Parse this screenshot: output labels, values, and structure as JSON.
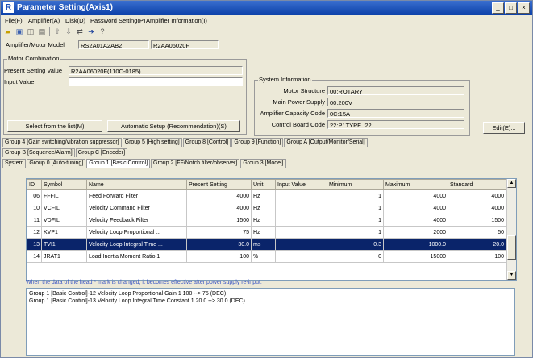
{
  "window": {
    "title": "Parameter Setting(Axis1)",
    "icon_letter": "R",
    "min_glyph": "_",
    "max_glyph": "□",
    "close_glyph": "×"
  },
  "menu": [
    "File(F)",
    "Amplifier(A)",
    "Disk(D)",
    "Password Setting(P)",
    "Amplifier Information(I)"
  ],
  "amp_motor": {
    "label": "Amplifier/Motor Model",
    "amp_value": "RS2A01A2AB2",
    "motor_value": "R2AA06020F"
  },
  "motor_combination": {
    "title": "Motor Combination",
    "present_label": "Present Setting Value",
    "present_value": "R2AA06020F(110C-0185)",
    "input_label": "Input Value",
    "input_value": "",
    "select_button": "Select from the list(M)",
    "auto_button": "Automatic Setup (Recommendation)(S)"
  },
  "system_info": {
    "title": "System Information",
    "rows": [
      {
        "label": "Motor Structure",
        "value": "00:ROTARY"
      },
      {
        "label": "Main Power Supply",
        "value": "00:200V"
      },
      {
        "label": "Amplifier Capacity Code",
        "value": "0C:15A"
      },
      {
        "label": "Control Board Code",
        "value": "22:P1TYPE_22"
      }
    ],
    "edit_button": "Edit(E)..."
  },
  "tabs": {
    "row1": [
      "Group 4 [Gain switching/vibration suppressor]",
      "Group 5 [High setting]",
      "Group 8 [Control]",
      "Group 9 [Function]",
      "Group A [Output/Monitor/Serial]"
    ],
    "row2": [
      "Group B [Sequence/Alarm]",
      "Group C [Encoder]"
    ],
    "row3": [
      "System",
      "Group 0 [Auto-tuning]",
      "Group 1 [Basic Control]",
      "Group 2 [FF/Notch filter/observer]",
      "Group 3 [Model]"
    ]
  },
  "table": {
    "columns": [
      "ID",
      "Symbol",
      "Name",
      "Present Setting",
      "Unit",
      "Input Value",
      "Minimum",
      "Maximum",
      "Standard"
    ],
    "rows": [
      {
        "id": "06",
        "symbol": "FFFIL",
        "name": "Feed Forward Filter",
        "present": "4000",
        "unit": "Hz",
        "input": "",
        "min": "1",
        "max": "4000",
        "std": "4000"
      },
      {
        "id": "10",
        "symbol": "VCFIL",
        "name": "Velocity Command Filter",
        "present": "4000",
        "unit": "Hz",
        "input": "",
        "min": "1",
        "max": "4000",
        "std": "4000"
      },
      {
        "id": "11",
        "symbol": "VDFIL",
        "name": "Velocity Feedback Filter",
        "present": "1500",
        "unit": "Hz",
        "input": "",
        "min": "1",
        "max": "4000",
        "std": "1500"
      },
      {
        "id": "12",
        "symbol": "KVP1",
        "name": "Velocity Loop Proportional ...",
        "present": "75",
        "unit": "Hz",
        "input": "",
        "min": "1",
        "max": "2000",
        "std": "50"
      },
      {
        "id": "13",
        "symbol": "TVI1",
        "name": "Velocity Loop Integral Time ...",
        "present": "30.0",
        "unit": "ms",
        "input": "",
        "min": "0.3",
        "max": "1000.0",
        "std": "20.0"
      },
      {
        "id": "14",
        "symbol": "JRAT1",
        "name": "Load Inertia Moment Ratio 1",
        "present": "100",
        "unit": "%",
        "input": "",
        "min": "0",
        "max": "15000",
        "std": "100"
      }
    ],
    "selected_row": 4
  },
  "note": "When the data of the head * mark is changed, it becomes effective after power supply re-input.",
  "log": [
    "Group 1 [Basic Control]-12 Velocity Loop Proportional Gain 1  100 --> 75 (DEC)",
    "Group 1 [Basic Control]-13 Velocity Loop Integral Time Constant 1  20.0 --> 30.0 (DEC)"
  ]
}
